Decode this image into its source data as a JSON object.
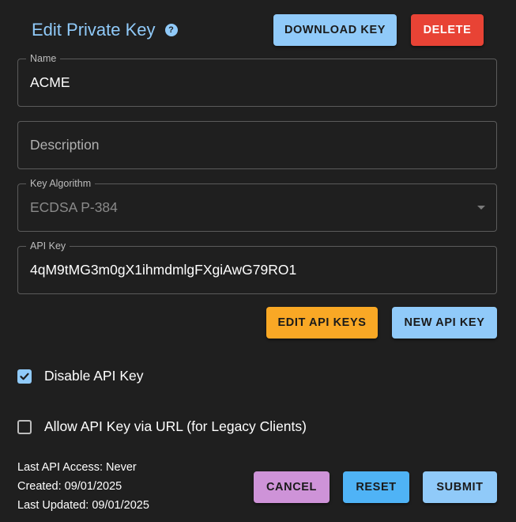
{
  "header": {
    "title": "Edit Private Key",
    "help_icon": "?",
    "download_label": "DOWNLOAD KEY",
    "delete_label": "DELETE"
  },
  "fields": {
    "name": {
      "label": "Name",
      "value": "ACME"
    },
    "description": {
      "placeholder": "Description",
      "value": ""
    },
    "algorithm": {
      "label": "Key Algorithm",
      "value": "ECDSA P-384"
    },
    "api_key": {
      "label": "API Key",
      "value": "4qM9tMG3m0gX1ihmdmlgFXgiAwG79RO1"
    }
  },
  "api_actions": {
    "edit_label": "EDIT API KEYS",
    "new_label": "NEW API KEY"
  },
  "checkboxes": {
    "disable_api_key": {
      "label": "Disable API Key",
      "checked": true
    },
    "allow_url": {
      "label": "Allow API Key via URL (for Legacy Clients)",
      "checked": false
    }
  },
  "meta": {
    "last_access": "Last API Access: Never",
    "created": "Created: 09/01/2025",
    "updated": "Last Updated: 09/01/2025"
  },
  "footer": {
    "cancel_label": "CANCEL",
    "reset_label": "RESET",
    "submit_label": "SUBMIT"
  },
  "colors": {
    "background": "#1f1f1f",
    "title": "#90caf9",
    "primary": "#90caf9",
    "danger": "#e84335",
    "warning": "#f9a825",
    "secondary": "#ce93d8",
    "info": "#4fb3f6"
  }
}
